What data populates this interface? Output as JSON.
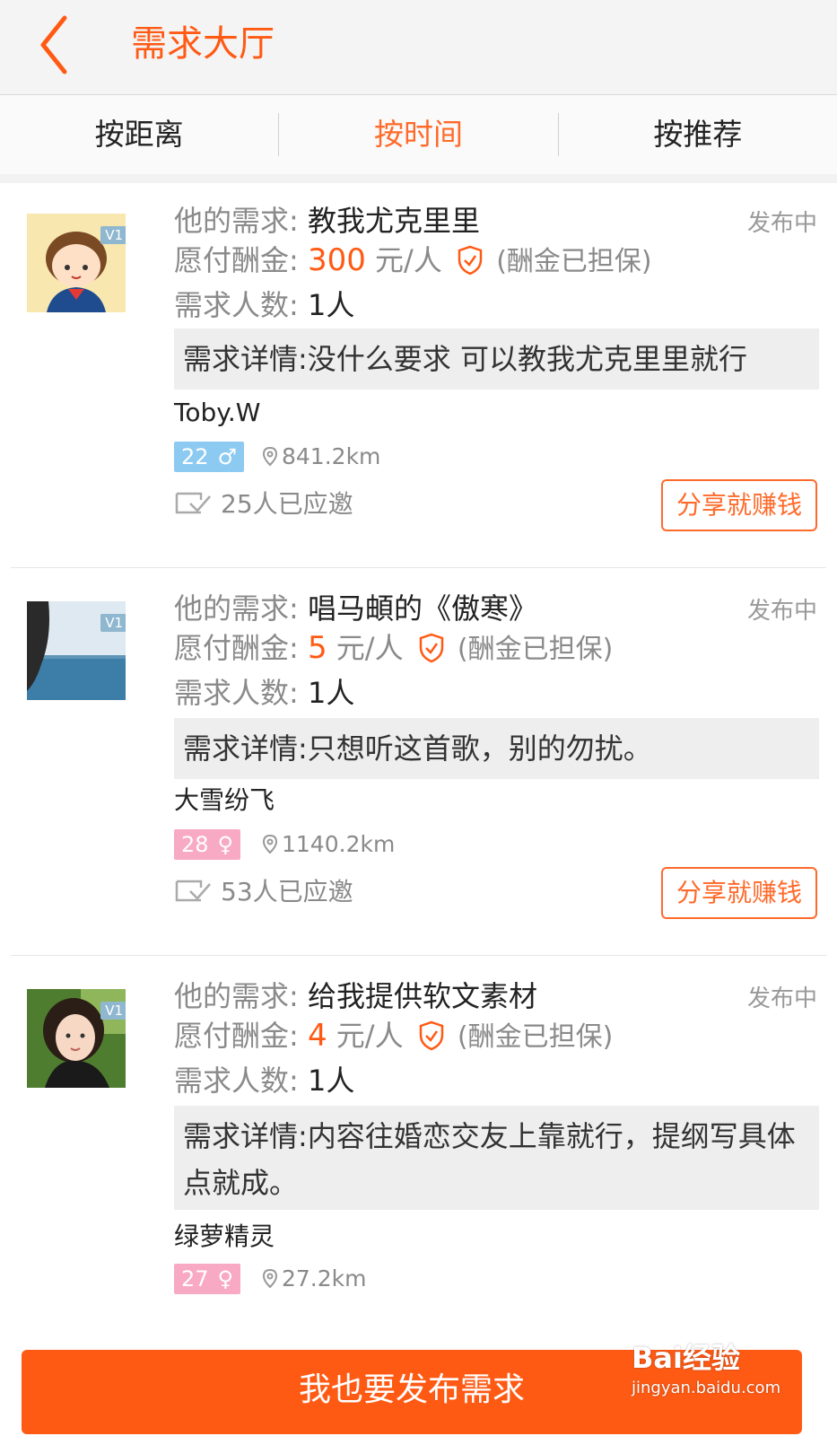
{
  "header": {
    "title": "需求大厅"
  },
  "tabs": [
    {
      "label": "按距离"
    },
    {
      "label": "按时间"
    },
    {
      "label": "按推荐"
    }
  ],
  "labels": {
    "demand": "他的需求:",
    "reward": "愿付酬金:",
    "count": "需求人数:",
    "unit": "元/人",
    "guaranteed": "(酬金已担保)",
    "share": "分享就赚钱",
    "vip": "V1"
  },
  "colors": {
    "accent": "#ff5a14",
    "male": "#8ccaf2",
    "female": "#f8a9c4"
  },
  "cards": [
    {
      "demand": "教我尤克里里",
      "status": "发布中",
      "reward": "300",
      "count": "1人",
      "detail": "需求详情:没什么要求 可以教我尤克里里就行",
      "user": "Toby.W",
      "age": "22",
      "gender": "male",
      "gender_icon": "♂",
      "distance": "841.2km",
      "invited": "25人已应邀"
    },
    {
      "demand": "唱马頔的《傲寒》",
      "status": "发布中",
      "reward": "5",
      "count": "1人",
      "detail": "需求详情:只想听这首歌，别的勿扰。",
      "user": "大雪纷飞",
      "age": "28",
      "gender": "female",
      "gender_icon": "♀",
      "distance": "1140.2km",
      "invited": "53人已应邀"
    },
    {
      "demand": "给我提供软文素材",
      "status": "发布中",
      "reward": "4",
      "count": "1人",
      "detail": "需求详情:内容往婚恋交友上靠就行，提纲写具体点就成。",
      "user": "绿萝精灵",
      "age": "27",
      "gender": "female",
      "gender_icon": "♀",
      "distance": "27.2km"
    }
  ],
  "bottom": {
    "publish": "我也要发布需求"
  },
  "watermark": {
    "logo": "Bai经验",
    "url": "jingyan.baidu.com"
  }
}
